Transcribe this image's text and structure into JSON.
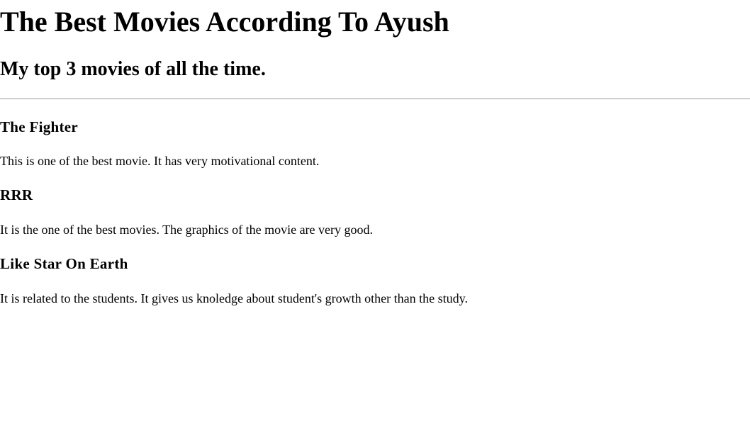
{
  "header": {
    "title": "The Best Movies According To Ayush",
    "subtitle": "My top 3 movies of all the time."
  },
  "movies": [
    {
      "title": "The Fighter",
      "description": "This is one of the best movie. It has very motivational content."
    },
    {
      "title": "RRR",
      "description": "It is the one of the best movies. The graphics of the movie are very good."
    },
    {
      "title": "Like Star On Earth",
      "description": "It is related to the students. It gives us knoledge about student's growth other than the study."
    }
  ]
}
